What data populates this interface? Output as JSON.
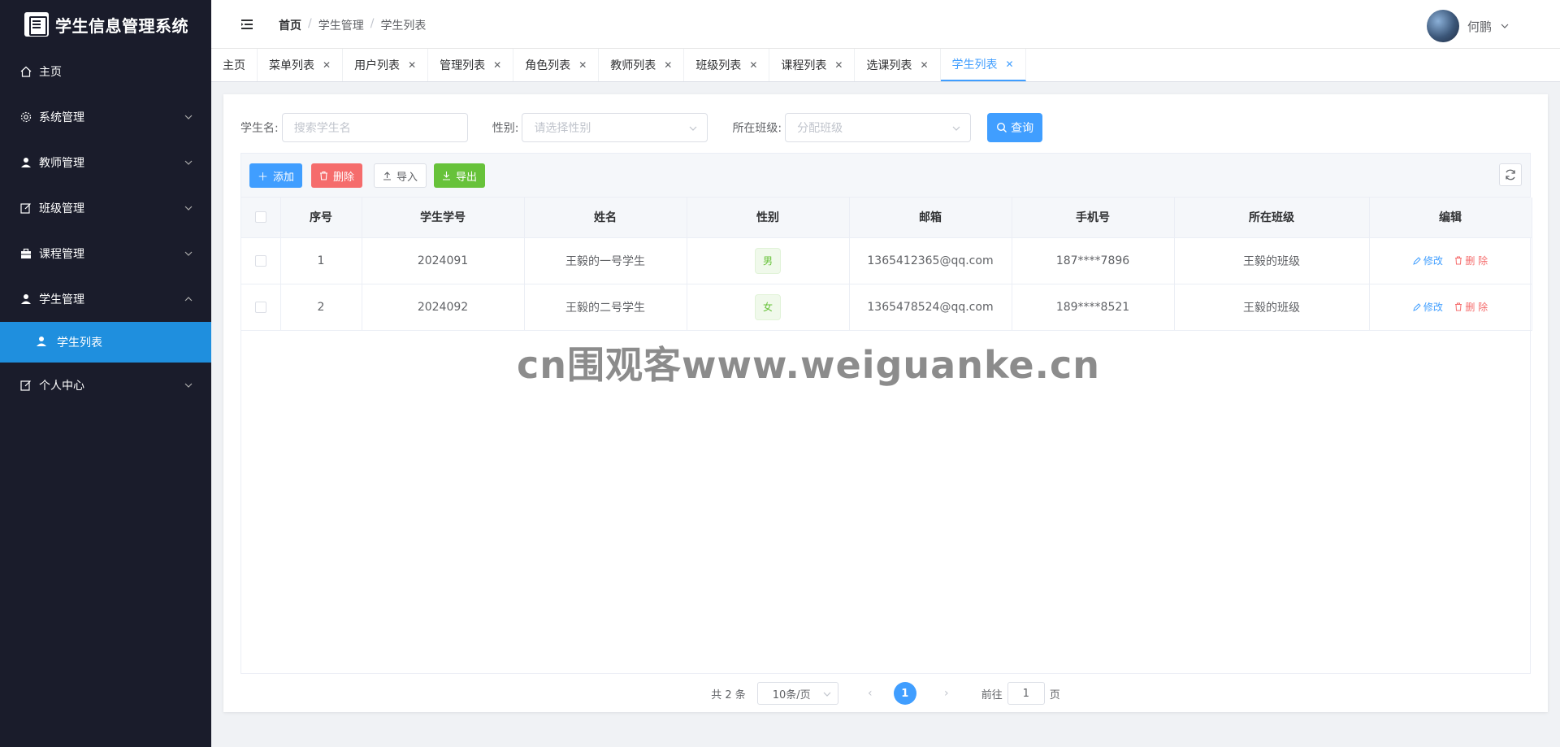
{
  "app": {
    "title": "学生信息管理系统"
  },
  "sidebar": {
    "items": [
      {
        "label": "主页",
        "icon": "home-icon"
      },
      {
        "label": "系统管理",
        "icon": "gear-icon"
      },
      {
        "label": "教师管理",
        "icon": "user-icon"
      },
      {
        "label": "班级管理",
        "icon": "edit-icon"
      },
      {
        "label": "课程管理",
        "icon": "briefcase-icon"
      },
      {
        "label": "学生管理",
        "icon": "user-icon",
        "expanded": true
      },
      {
        "label": "个人中心",
        "icon": "edit-icon"
      }
    ],
    "subitem": {
      "label": "学生列表",
      "icon": "user-icon"
    }
  },
  "header": {
    "breadcrumb": [
      "首页",
      "学生管理",
      "学生列表"
    ],
    "username": "何鹏"
  },
  "tabs": [
    {
      "label": "主页",
      "closable": false
    },
    {
      "label": "菜单列表",
      "closable": true
    },
    {
      "label": "用户列表",
      "closable": true
    },
    {
      "label": "管理列表",
      "closable": true
    },
    {
      "label": "角色列表",
      "closable": true
    },
    {
      "label": "教师列表",
      "closable": true
    },
    {
      "label": "班级列表",
      "closable": true
    },
    {
      "label": "课程列表",
      "closable": true
    },
    {
      "label": "选课列表",
      "closable": true
    },
    {
      "label": "学生列表",
      "closable": true,
      "active": true
    }
  ],
  "search": {
    "name_label": "学生名:",
    "name_placeholder": "搜索学生名",
    "gender_label": "性别:",
    "gender_placeholder": "请选择性别",
    "class_label": "所在班级:",
    "class_placeholder": "分配班级",
    "query_label": "查询"
  },
  "toolbar": {
    "add_label": "添加",
    "delete_label": "删除",
    "import_label": "导入",
    "export_label": "导出"
  },
  "table": {
    "columns": [
      "序号",
      "学生学号",
      "姓名",
      "性别",
      "邮箱",
      "手机号",
      "所在班级",
      "编辑"
    ],
    "rows": [
      {
        "index": "1",
        "student_no": "2024091",
        "name": "王毅的一号学生",
        "gender": "男",
        "email": "1365412365@qq.com",
        "phone": "187****7896",
        "class": "王毅的班级"
      },
      {
        "index": "2",
        "student_no": "2024092",
        "name": "王毅的二号学生",
        "gender": "女",
        "email": "1365478524@qq.com",
        "phone": "189****8521",
        "class": "王毅的班级"
      }
    ],
    "edit_label": "修改",
    "delete_label": "删 除"
  },
  "pagination": {
    "total": "共 2 条",
    "page_size": "10条/页",
    "current_page": "1",
    "goto_label": "前往",
    "goto_value": "1",
    "goto_suffix": "页"
  },
  "watermark": "cn围观客www.weiguanke.cn",
  "colors": {
    "sidebar_bg": "#1a1c2b",
    "active_menu": "#1f8fde",
    "primary": "#409eff",
    "danger": "#f56c6c",
    "success": "#67c23a"
  }
}
